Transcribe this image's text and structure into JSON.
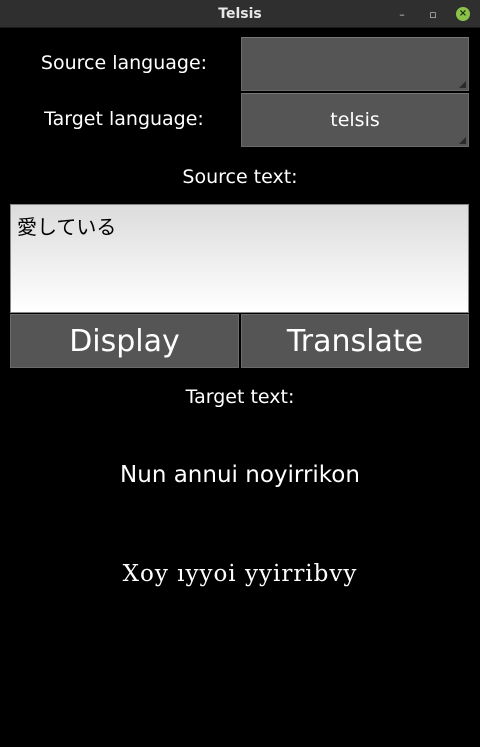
{
  "window": {
    "title": "Telsis",
    "minimize_glyph": "–",
    "maximize_glyph": "▫",
    "close_glyph": "×"
  },
  "form": {
    "source_language_label": "Source language:",
    "source_language_value": "",
    "target_language_label": "Target language:",
    "target_language_value": "telsis",
    "source_text_label": "Source text:",
    "source_text_value": "愛している",
    "display_button": "Display",
    "translate_button": "Translate",
    "target_text_label": "Target text:"
  },
  "output": {
    "romanized": "Nun annui noyirrikon",
    "script_rendering": "Xoy ıyyoi yyirribvy"
  }
}
